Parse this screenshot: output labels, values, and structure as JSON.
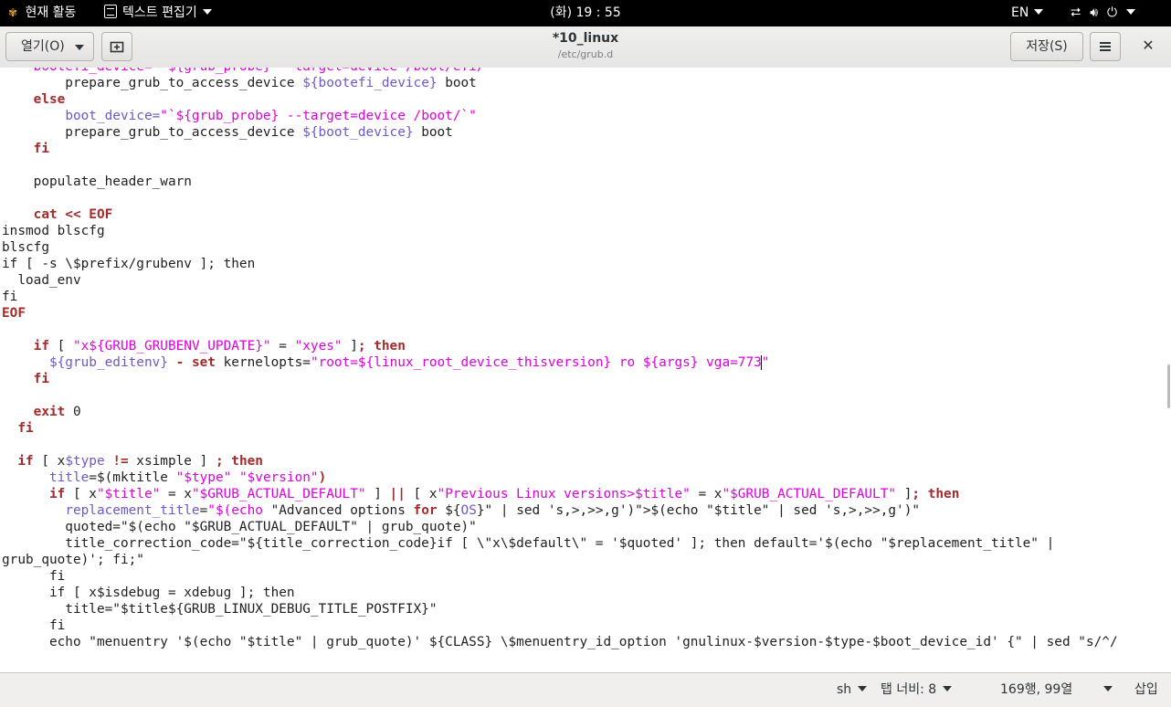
{
  "topbar": {
    "activities": "현재 활동",
    "app_name": "텍스트 편집기",
    "clock": "(화) 19 : 55",
    "input_lang": "EN"
  },
  "header": {
    "open_label": "열기(O)",
    "title": "*10_linux",
    "subtitle": "/etc/grub.d",
    "save_label": "저장(S)"
  },
  "editor": {
    "lines": [
      [
        [
          "    ",
          ""
        ],
        [
          "bootefi_device=\"`${grub_probe} --target=device /boot/efi/`\"",
          "st"
        ]
      ],
      [
        [
          "        prepare_grub_to_access_device ",
          ""
        ],
        [
          "${bootefi_device}",
          "va"
        ],
        [
          " boot",
          ""
        ]
      ],
      [
        [
          "    ",
          ""
        ],
        [
          "else",
          "kw"
        ]
      ],
      [
        [
          "        ",
          ""
        ],
        [
          "boot_device=",
          "va"
        ],
        [
          "\"`${grub_probe} --target=device /boot/`\"",
          "st"
        ]
      ],
      [
        [
          "        prepare_grub_to_access_device ",
          ""
        ],
        [
          "${boot_device}",
          "va"
        ],
        [
          " boot",
          ""
        ]
      ],
      [
        [
          "    ",
          ""
        ],
        [
          "fi",
          "kw"
        ]
      ],
      [
        [
          "",
          ""
        ]
      ],
      [
        [
          "    populate_header_warn",
          ""
        ]
      ],
      [
        [
          "",
          ""
        ]
      ],
      [
        [
          "    ",
          ""
        ],
        [
          "cat << EOF",
          "kw"
        ]
      ],
      [
        [
          "insmod blscfg",
          ""
        ]
      ],
      [
        [
          "blscfg",
          ""
        ]
      ],
      [
        [
          "if [ -s \\$prefix/grubenv ]; then",
          ""
        ]
      ],
      [
        [
          "  load_env",
          ""
        ]
      ],
      [
        [
          "fi",
          ""
        ]
      ],
      [
        [
          "EOF",
          "kw"
        ]
      ],
      [
        [
          "",
          ""
        ]
      ],
      [
        [
          "    ",
          ""
        ],
        [
          "if",
          "kw"
        ],
        [
          " [ ",
          ""
        ],
        [
          "\"x${GRUB_GRUBENV_UPDATE}\"",
          "st"
        ],
        [
          " = ",
          ""
        ],
        [
          "\"xyes\"",
          "st"
        ],
        [
          " ]",
          ""
        ],
        [
          "; then",
          "kw"
        ]
      ],
      [
        [
          "      ",
          ""
        ],
        [
          "${grub_editenv}",
          "va"
        ],
        [
          " ",
          ""
        ],
        [
          "-",
          "kw"
        ],
        [
          " ",
          ""
        ],
        [
          "set",
          "kw"
        ],
        [
          " kernelopts=",
          ""
        ],
        [
          "\"root=${linux_root_device_thisversion} ro ${args} vga=773",
          "st"
        ],
        [
          "|cursor",
          "cursor"
        ],
        [
          "\"",
          "st"
        ]
      ],
      [
        [
          "    ",
          ""
        ],
        [
          "fi",
          "kw"
        ]
      ],
      [
        [
          "",
          ""
        ]
      ],
      [
        [
          "    ",
          ""
        ],
        [
          "exit",
          "kw"
        ],
        [
          " 0",
          ""
        ]
      ],
      [
        [
          "  ",
          ""
        ],
        [
          "fi",
          "kw"
        ]
      ],
      [
        [
          "",
          ""
        ]
      ],
      [
        [
          "  ",
          ""
        ],
        [
          "if",
          "kw"
        ],
        [
          " [ x",
          ""
        ],
        [
          "$type",
          "va"
        ],
        [
          " ",
          ""
        ],
        [
          "!=",
          "kw"
        ],
        [
          " xsimple ] ",
          ""
        ],
        [
          "; then",
          "kw"
        ]
      ],
      [
        [
          "      ",
          ""
        ],
        [
          "title",
          "va"
        ],
        [
          "=$(mktitle ",
          ""
        ],
        [
          "\"$type\"",
          "st"
        ],
        [
          " ",
          ""
        ],
        [
          "\"$version\"",
          "st"
        ],
        [
          ")",
          "kw"
        ]
      ],
      [
        [
          "      ",
          ""
        ],
        [
          "if",
          "kw"
        ],
        [
          " [ x",
          ""
        ],
        [
          "\"$title\"",
          "st"
        ],
        [
          " = x",
          ""
        ],
        [
          "\"$GRUB_ACTUAL_DEFAULT\"",
          "st"
        ],
        [
          " ] ",
          ""
        ],
        [
          "||",
          "kw"
        ],
        [
          " [ x",
          ""
        ],
        [
          "\"Previous Linux versions>$title\"",
          "st"
        ],
        [
          " = x",
          ""
        ],
        [
          "\"$GRUB_ACTUAL_DEFAULT\"",
          "st"
        ],
        [
          " ]",
          ""
        ],
        [
          "; then",
          "kw"
        ]
      ],
      [
        [
          "        ",
          ""
        ],
        [
          "replacement_title",
          "va"
        ],
        [
          "=",
          ""
        ],
        [
          "\"$(echo ",
          "st"
        ],
        [
          "\"Advanced options ",
          ""
        ],
        [
          "for",
          "kw"
        ],
        [
          " ${",
          ""
        ],
        [
          "OS",
          "va"
        ],
        [
          "}\" | sed 's,>,>>,g')\">$(echo \"$title\" | sed 's,>,>>,g')\"",
          ""
        ]
      ],
      [
        [
          "        quoted=\"$(echo \"$GRUB_ACTUAL_DEFAULT\" | grub_quote)\"",
          ""
        ]
      ],
      [
        [
          "        title_correction_code=\"${title_correction_code}if [ \\\"x\\$default\\\" = '$quoted' ]; then default='$(echo \"$replacement_title\" |",
          ""
        ]
      ],
      [
        [
          "grub_quote)'; fi;\"",
          ""
        ]
      ],
      [
        [
          "      fi",
          ""
        ]
      ],
      [
        [
          "      if [ x$isdebug = xdebug ]; then",
          ""
        ]
      ],
      [
        [
          "        title=\"$title${GRUB_LINUX_DEBUG_TITLE_POSTFIX}\"",
          ""
        ]
      ],
      [
        [
          "      fi",
          ""
        ]
      ],
      [
        [
          "      echo \"menuentry '$(echo \"$title\" | grub_quote)' ${CLASS} \\$menuentry_id_option 'gnulinux-$version-$type-$boot_device_id' {\" | sed \"s/^/",
          ""
        ]
      ]
    ]
  },
  "statusbar": {
    "language": "sh",
    "tab_width": "탭 너비: 8",
    "position": "169행, 99열",
    "mode": "삽입"
  }
}
